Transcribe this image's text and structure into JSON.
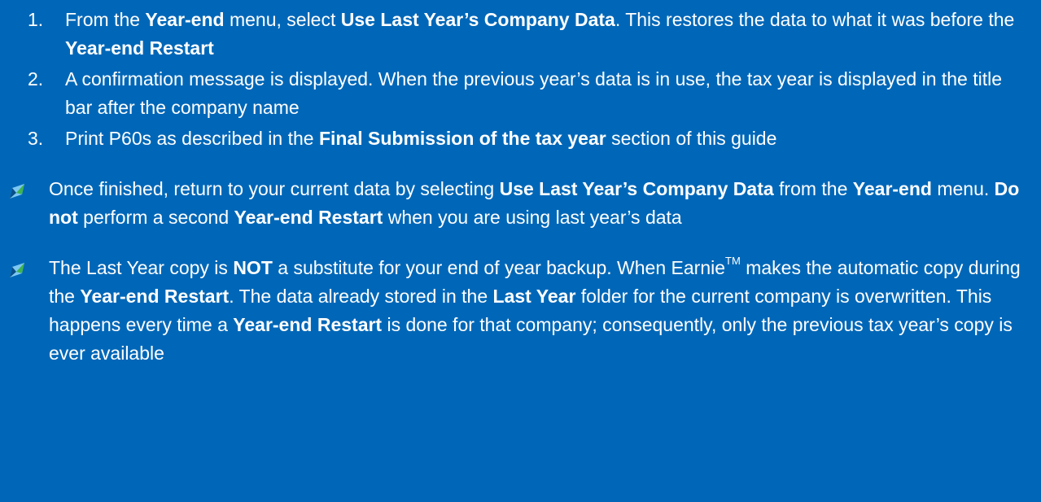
{
  "steps": [
    {
      "number": "1.",
      "parts": [
        {
          "text": "From the ",
          "bold": false
        },
        {
          "text": "Year-end",
          "bold": true
        },
        {
          "text": " menu, select ",
          "bold": false
        },
        {
          "text": "Use Last Year’s Company Data",
          "bold": true
        },
        {
          "text": ". This restores the data to what it was before the ",
          "bold": false
        },
        {
          "text": "Year-end Restart",
          "bold": true
        }
      ]
    },
    {
      "number": "2.",
      "parts": [
        {
          "text": "A confirmation message is displayed. When the previous year’s data is in use, the tax year is displayed in the title bar after the company name",
          "bold": false
        }
      ]
    },
    {
      "number": "3.",
      "parts": [
        {
          "text": "Print P60s as described in the ",
          "bold": false
        },
        {
          "text": "Final Submission of the tax year",
          "bold": true
        },
        {
          "text": " section of this guide",
          "bold": false
        }
      ]
    }
  ],
  "notes": [
    {
      "icon": "note-icon",
      "parts": [
        {
          "text": "Once finished, return to your current data by selecting ",
          "bold": false
        },
        {
          "text": "Use Last Year’s Company Data",
          "bold": true
        },
        {
          "text": " from the ",
          "bold": false
        },
        {
          "text": "Year-end",
          "bold": true
        },
        {
          "text": " menu. ",
          "bold": false
        },
        {
          "text": "Do not",
          "bold": true
        },
        {
          "text": " perform a second ",
          "bold": false
        },
        {
          "text": "Year-end Restart",
          "bold": true
        },
        {
          "text": " when you are using last year’s data",
          "bold": false
        }
      ]
    },
    {
      "icon": "note-icon",
      "parts": [
        {
          "text": "The Last Year copy is ",
          "bold": false
        },
        {
          "text": "NOT",
          "bold": true
        },
        {
          "text": " a substitute for your end of year backup. When Earnie",
          "bold": false
        },
        {
          "text": "TM",
          "bold": false,
          "sup": true
        },
        {
          "text": " makes the automatic copy during the ",
          "bold": false
        },
        {
          "text": "Year-end Restart",
          "bold": true
        },
        {
          "text": ". The data already stored in the ",
          "bold": false
        },
        {
          "text": "Last Year",
          "bold": true
        },
        {
          "text": " folder for the current company is overwritten. This happens every time a ",
          "bold": false
        },
        {
          "text": "Year-end Restart",
          "bold": true
        },
        {
          "text": " is done for that company; consequently, only the previous tax year’s copy is ever available",
          "bold": false
        }
      ]
    }
  ],
  "colors": {
    "background": "#0067b8",
    "text": "#ffffff",
    "icon_light": "#7cc8f2",
    "icon_dark": "#0a4f8a",
    "icon_accent": "#3fb34f"
  }
}
